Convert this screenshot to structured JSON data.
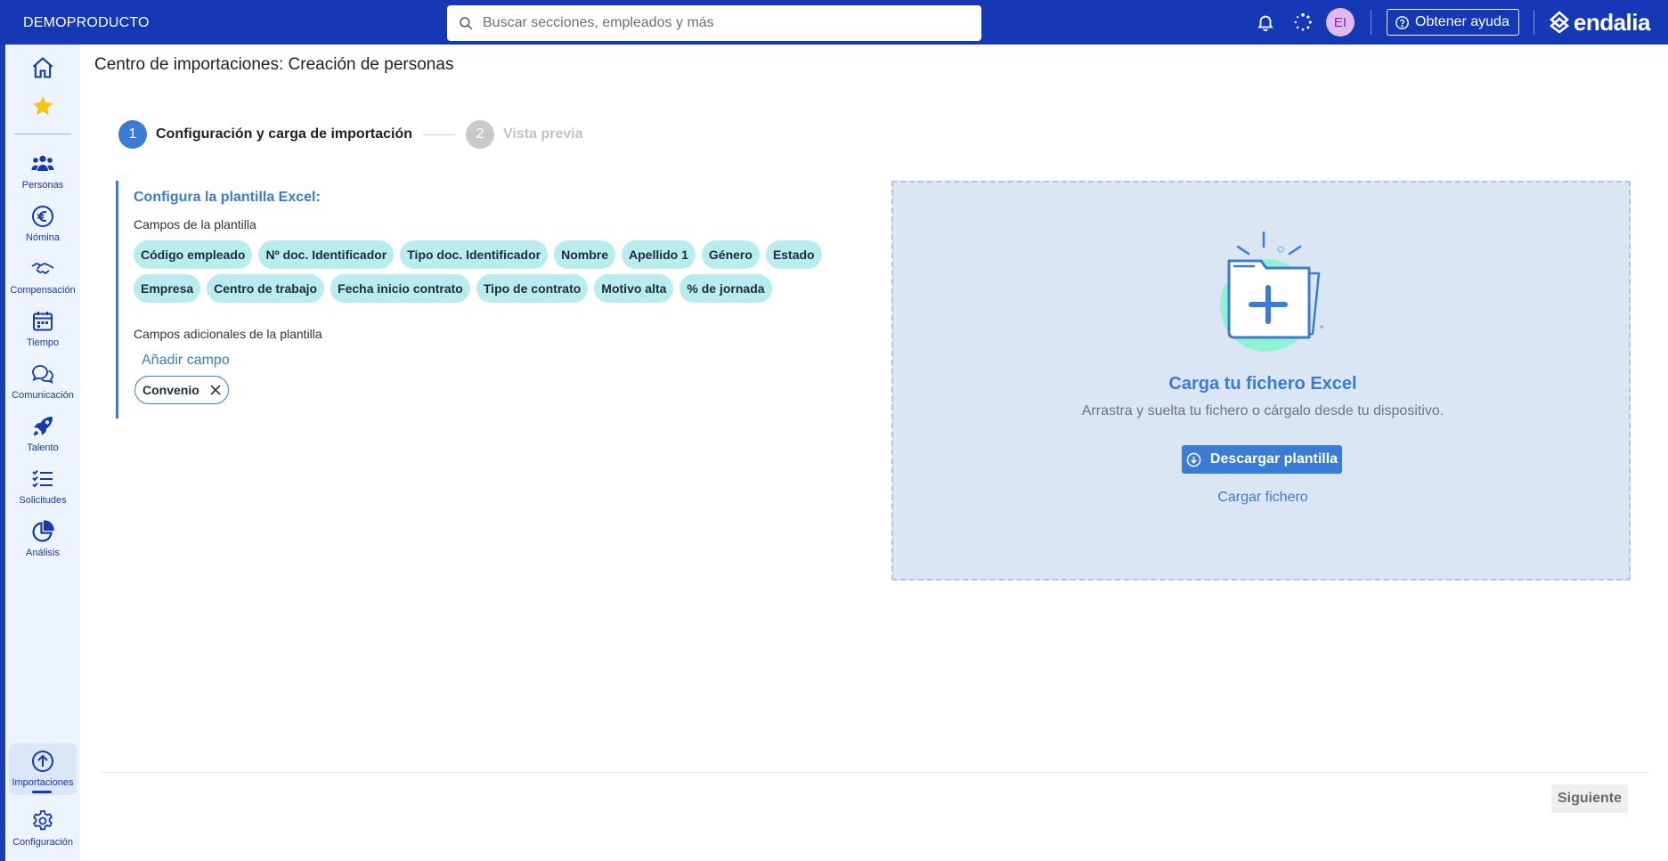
{
  "topbar": {
    "brand": "DEMOPRODUCTO",
    "search_placeholder": "Buscar secciones, empleados y más",
    "avatar_initials": "EI",
    "help_label": "Obtener ayuda",
    "logo_text": "endalia",
    "bg_color": "#1438b6"
  },
  "sidebar": {
    "items": [
      {
        "label": "Personas",
        "icon": "people-icon"
      },
      {
        "label": "Nómina",
        "icon": "euro-icon"
      },
      {
        "label": "Compensación",
        "icon": "handshake-icon"
      },
      {
        "label": "Tiempo",
        "icon": "calendar-icon"
      },
      {
        "label": "Comunicación",
        "icon": "chat-icon"
      },
      {
        "label": "Talento",
        "icon": "rocket-icon"
      },
      {
        "label": "Solicitudes",
        "icon": "checklist-icon"
      },
      {
        "label": "Análisis",
        "icon": "pie-chart-icon"
      }
    ],
    "bottom_items": [
      {
        "label": "Importaciones",
        "icon": "upload-icon",
        "active": true
      },
      {
        "label": "Configuración",
        "icon": "gear-icon"
      }
    ]
  },
  "page": {
    "title": "Centro de importaciones: Creación de personas"
  },
  "stepper": {
    "steps": [
      {
        "number": "1",
        "label": "Configuración y carga de importación",
        "state": "active"
      },
      {
        "number": "2",
        "label": "Vista previa",
        "state": "inactive"
      }
    ]
  },
  "config": {
    "title": "Configura la plantilla Excel:",
    "fields_heading": "Campos de la plantilla",
    "fields_row1": [
      "Código empleado",
      "Nº doc. Identificador",
      "Tipo doc. Identificador",
      "Nombre",
      "Apellido 1",
      "Género",
      "Estado"
    ],
    "fields_row2": [
      "Empresa",
      "Centro de trabajo",
      "Fecha inicio contrato",
      "Tipo de contrato",
      "Motivo alta",
      "% de jornada"
    ],
    "additional_heading": "Campos adicionales de la plantilla",
    "add_field_label": "Añadir campo",
    "additional_fields": [
      "Convenio"
    ]
  },
  "dropzone": {
    "title": "Carga tu fichero Excel",
    "description": "Arrastra y suelta tu fichero o cárgalo desde tu dispositivo.",
    "download_label": "Descargar plantilla",
    "upload_link": "Cargar fichero"
  },
  "footer": {
    "next_label": "Siguiente"
  }
}
